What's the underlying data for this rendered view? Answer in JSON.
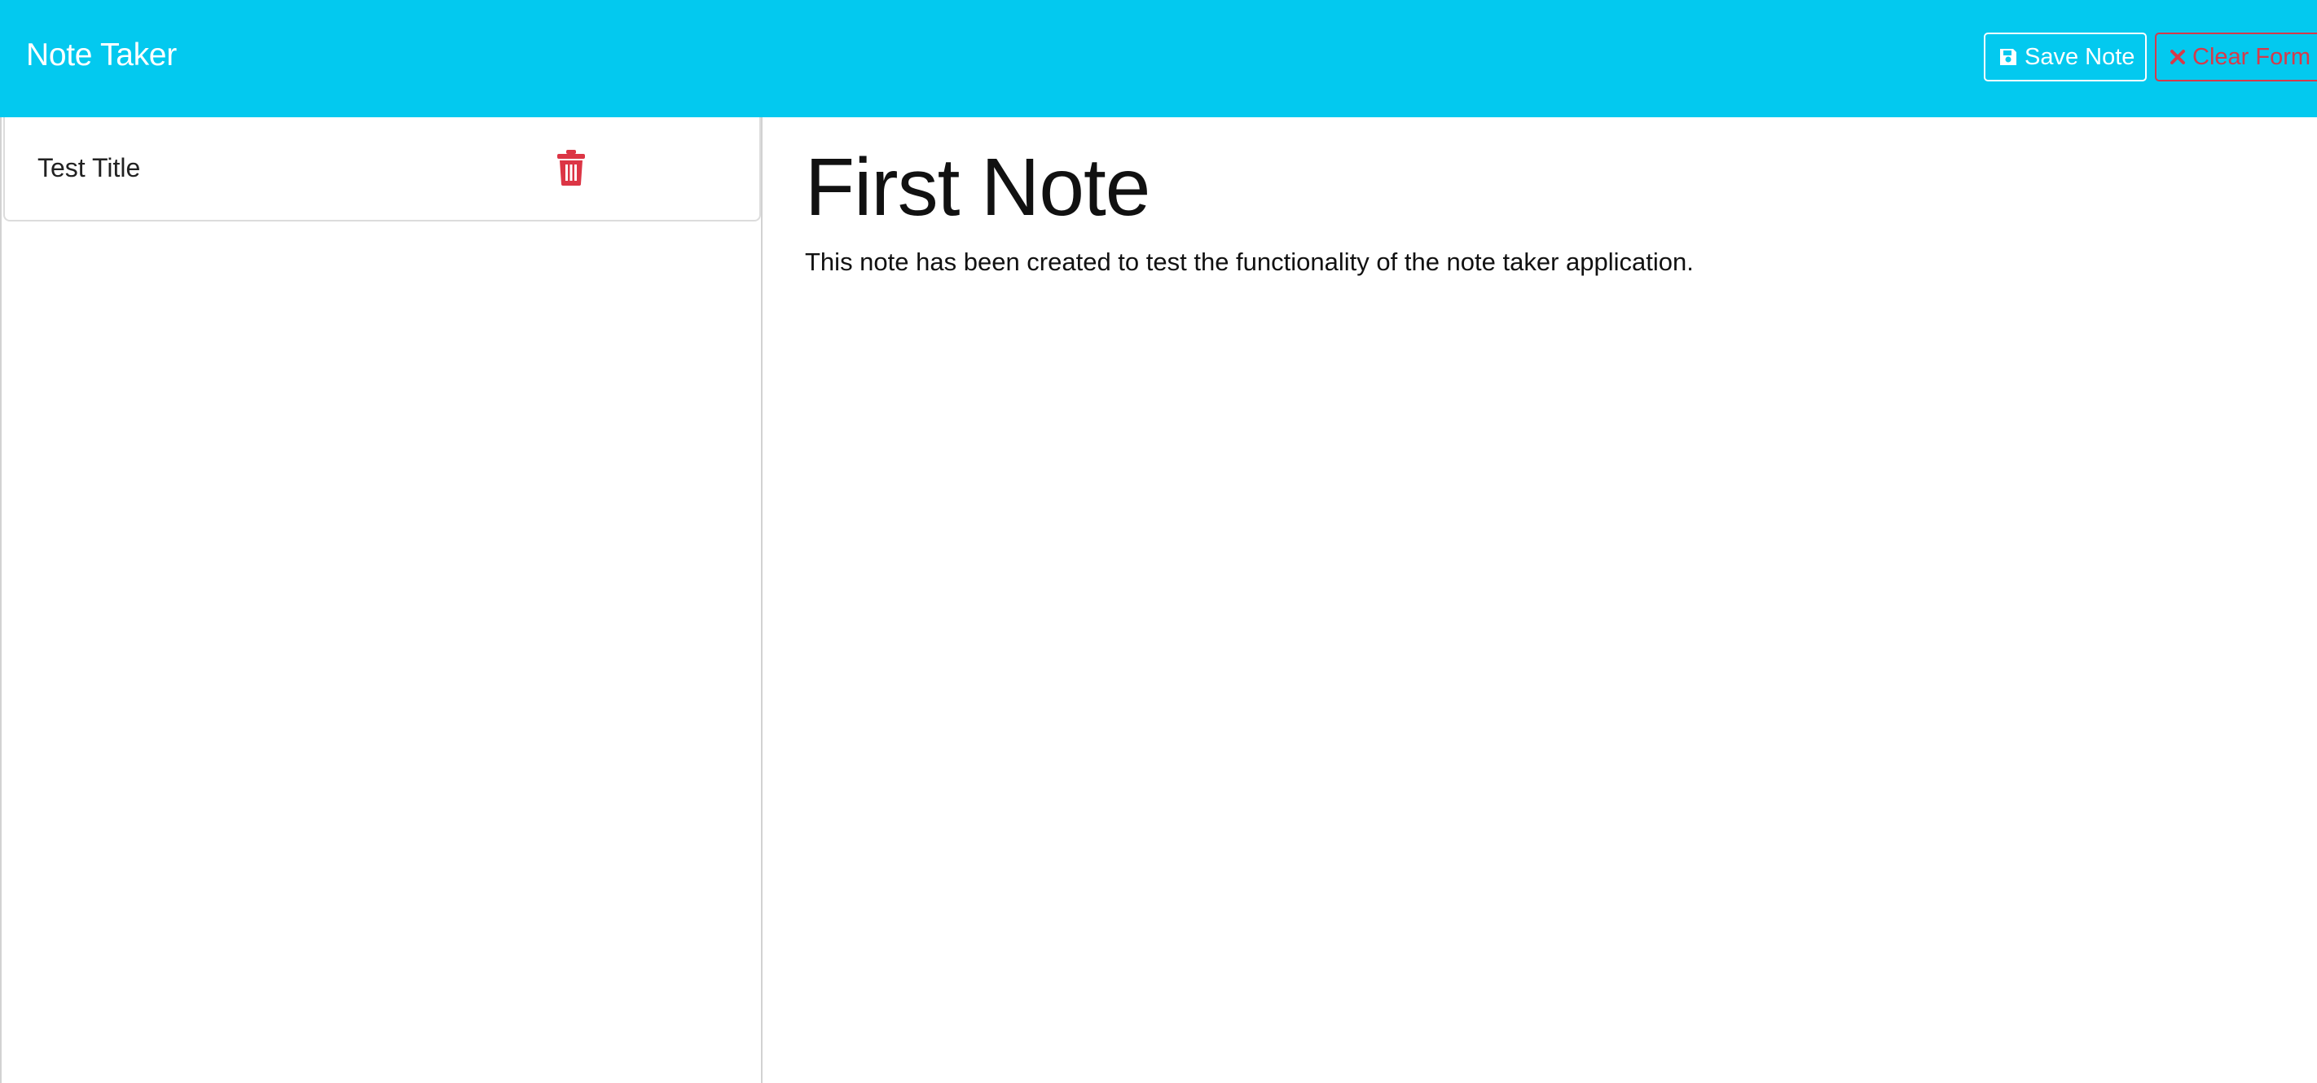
{
  "navbar": {
    "brand": "Note Taker",
    "save_label": "Save Note",
    "clear_label": "Clear Form",
    "save_icon": "floppy-disk-icon",
    "clear_icon": "x-icon",
    "background_color": "#03c9ef",
    "clear_color": "#d63a4a"
  },
  "sidebar": {
    "notes": [
      {
        "title": "Test Title",
        "delete_icon": "trash-icon",
        "delete_color": "#dc3545"
      }
    ]
  },
  "note": {
    "title": "First Note",
    "text": "This note has been created to test the functionality of the note taker application."
  }
}
